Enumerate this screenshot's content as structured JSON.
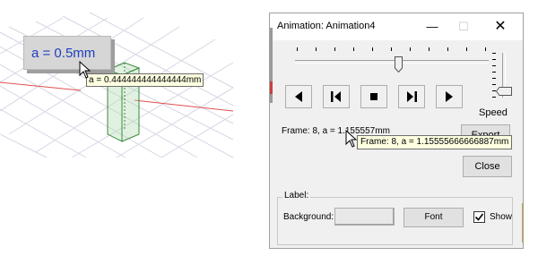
{
  "scene": {
    "value_label": "a = 0.5mm",
    "tooltip": "a = 0.444444444444444mm",
    "colors": {
      "label_text": "#1f3fbf",
      "axis_red": "#e05050",
      "box_green": "#3a8a3a"
    }
  },
  "dialog": {
    "title": "Animation: Animation4",
    "titlebar": {
      "minimize": "—",
      "maximize": "☐",
      "close": "✕"
    },
    "frame_slider_position": 0.52,
    "speed_slider_position": 0.85,
    "speed_label": "Speed",
    "playback": [
      {
        "name": "play-backward-button",
        "icon": "play-reverse-icon"
      },
      {
        "name": "step-back-button",
        "icon": "step-back-icon"
      },
      {
        "name": "stop-button",
        "icon": "stop-icon"
      },
      {
        "name": "step-forward-button",
        "icon": "step-forward-icon"
      },
      {
        "name": "play-forward-button",
        "icon": "play-icon"
      }
    ],
    "frame_text": "Frame: 8, a = 1.155557mm",
    "tooltip": "Frame: 8, a = 1.15555666666887mm",
    "export_label": "Export",
    "close_label": "Close",
    "label_group": {
      "title": "Label:",
      "background_label": "Background:",
      "font_label": "Font",
      "show_label": "Show",
      "show_checked": true,
      "checkmark": "✓"
    }
  }
}
